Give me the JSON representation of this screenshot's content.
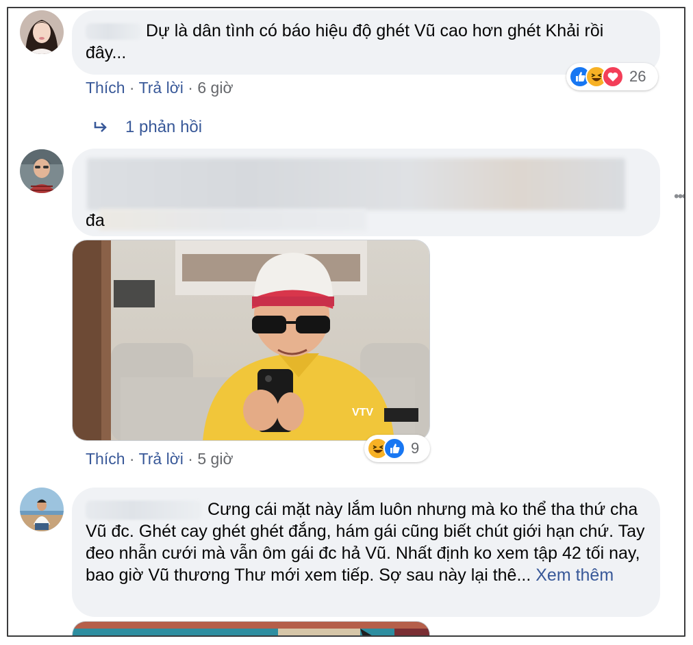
{
  "comments": [
    {
      "text": "Dự là dân tình có báo hiệu độ ghét Vũ cao hơn ghét Khải rồi đây...",
      "actions": {
        "like": "Thích",
        "reply": "Trả lời",
        "time": "6 giờ"
      },
      "reactions": {
        "icons": [
          "like-icon",
          "haha-icon",
          "love-icon"
        ],
        "count": "26"
      },
      "replies_label": "1 phản hồi"
    },
    {
      "text_visible_fragment": "đa",
      "actions": {
        "like": "Thích",
        "reply": "Trả lời",
        "time": "5 giờ"
      },
      "reactions": {
        "icons": [
          "haha-icon",
          "like-icon"
        ],
        "count": "9"
      },
      "photo_watermark": "VTV"
    },
    {
      "text": "Cưng cái mặt này lắm luôn nhưng mà ko thể tha thứ cha Vũ đc. Ghét cay ghét ghét đắng, hám gái cũng biết chút giới hạn chứ. Tay đeo nhẫn cưới mà vẫn ôm gái đc hả Vũ. Nhất định ko xem tập 42 tối nay, bao giờ Vũ thương Thư mới xem tiếp. Sợ sau này lại thê...",
      "see_more": "Xem thêm"
    }
  ],
  "colors": {
    "bubble": "#f0f2f5",
    "link": "#385898",
    "meta": "#65676b",
    "like": "#1877f2",
    "haha": "#f7b125",
    "love": "#f33e58"
  }
}
